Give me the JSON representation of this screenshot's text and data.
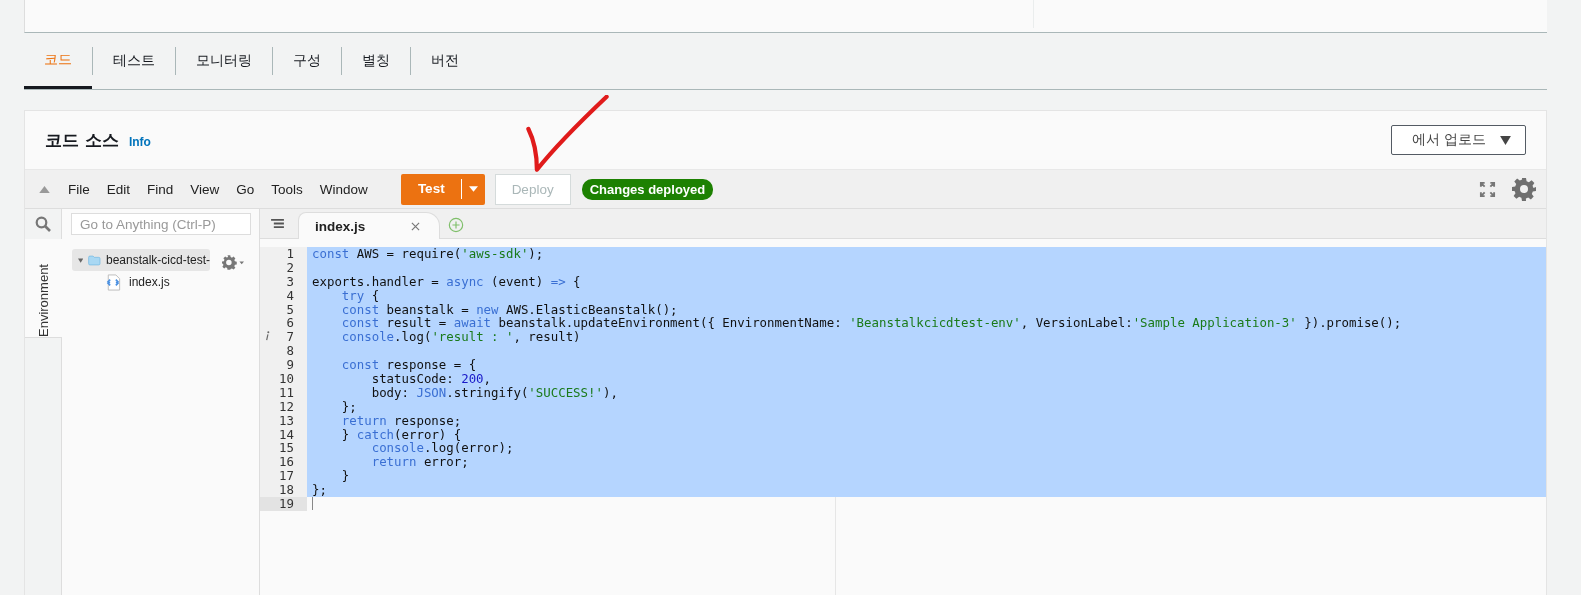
{
  "tabs": [
    {
      "label": "코드",
      "selected": true
    },
    {
      "label": "테스트",
      "selected": false
    },
    {
      "label": "모니터링",
      "selected": false
    },
    {
      "label": "구성",
      "selected": false
    },
    {
      "label": "별칭",
      "selected": false
    },
    {
      "label": "버전",
      "selected": false
    }
  ],
  "code_source": {
    "title": "코드 소스",
    "info_link": "Info",
    "upload_button": "에서 업로드"
  },
  "menu": [
    "File",
    "Edit",
    "Find",
    "View",
    "Go",
    "Tools",
    "Window"
  ],
  "test_button": "Test",
  "deploy_button": {
    "label": "Deploy",
    "disabled": true
  },
  "status_badge": "Changes deployed",
  "search": {
    "placeholder": "Go to Anything (Ctrl-P)"
  },
  "side_tab": "Environment",
  "tree": [
    {
      "name": "beanstalk-cicd-test-",
      "kind": "folder",
      "expanded": true,
      "selected": true,
      "children": [
        {
          "name": "index.js",
          "kind": "file",
          "selected": false
        }
      ]
    }
  ],
  "editor_tabs": [
    {
      "label": "index.js",
      "selected": true
    }
  ],
  "code_lines": [
    {
      "n": "1",
      "selected": true,
      "tokens": [
        {
          "kind": "keyword",
          "t": "const"
        },
        {
          "kind": "plain",
          "t": " AWS = require("
        },
        {
          "kind": "string",
          "t": "'aws-sdk'"
        },
        {
          "kind": "plain",
          "t": ");"
        }
      ]
    },
    {
      "n": "2",
      "selected": true
    },
    {
      "n": "3",
      "selected": true,
      "tokens": [
        {
          "kind": "plain",
          "t": "exports.handler = "
        },
        {
          "kind": "keyword",
          "t": "async"
        },
        {
          "kind": "plain",
          "t": " (event) "
        },
        {
          "kind": "keyword",
          "t": "=>"
        },
        {
          "kind": "plain",
          "t": " {"
        }
      ]
    },
    {
      "n": "4",
      "selected": true,
      "tokens": [
        {
          "kind": "keyword",
          "t": "    try"
        },
        {
          "kind": "plain",
          "t": " {"
        }
      ]
    },
    {
      "n": "5",
      "selected": true,
      "tokens": [
        {
          "kind": "keyword",
          "t": "    const"
        },
        {
          "kind": "plain",
          "t": " beanstalk = "
        },
        {
          "kind": "keyword",
          "t": "new"
        },
        {
          "kind": "plain",
          "t": " AWS.ElasticBeanstalk();"
        }
      ]
    },
    {
      "n": "6",
      "selected": true,
      "tokens": [
        {
          "kind": "keyword",
          "t": "    const"
        },
        {
          "kind": "plain",
          "t": " result = "
        },
        {
          "kind": "keyword",
          "t": "await"
        },
        {
          "kind": "plain",
          "t": " beanstalk.updateEnvironment({ EnvironmentName: "
        },
        {
          "kind": "string",
          "t": "'Beanstalkcicdtest-env'"
        },
        {
          "kind": "plain",
          "t": ", VersionLabel:"
        },
        {
          "kind": "string",
          "t": "'Sample Application-3'"
        },
        {
          "kind": "plain",
          "t": " }).promise();"
        }
      ]
    },
    {
      "n": "7",
      "selected": true,
      "info_marker": true,
      "tokens": [
        {
          "kind": "keyword",
          "t": "    console"
        },
        {
          "kind": "plain",
          "t": ".log("
        },
        {
          "kind": "string",
          "t": "'result : '"
        },
        {
          "kind": "plain",
          "t": ", result)"
        }
      ]
    },
    {
      "n": "8",
      "selected": true
    },
    {
      "n": "9",
      "selected": true,
      "tokens": [
        {
          "kind": "keyword",
          "t": "    const"
        },
        {
          "kind": "plain",
          "t": " response = {"
        }
      ]
    },
    {
      "n": "10",
      "selected": true,
      "tokens": [
        {
          "kind": "plain",
          "t": "        statusCode: "
        },
        {
          "kind": "number",
          "t": "200"
        },
        {
          "kind": "plain",
          "t": ","
        }
      ]
    },
    {
      "n": "11",
      "selected": true,
      "tokens": [
        {
          "kind": "plain",
          "t": "        body: "
        },
        {
          "kind": "keyword",
          "t": "JSON"
        },
        {
          "kind": "plain",
          "t": ".stringify("
        },
        {
          "kind": "string",
          "t": "'SUCCESS!'"
        },
        {
          "kind": "plain",
          "t": "),"
        }
      ]
    },
    {
      "n": "12",
      "selected": true,
      "tokens": [
        {
          "kind": "plain",
          "t": "    };"
        }
      ]
    },
    {
      "n": "13",
      "selected": true,
      "tokens": [
        {
          "kind": "keyword",
          "t": "    return"
        },
        {
          "kind": "plain",
          "t": " response;"
        }
      ]
    },
    {
      "n": "14",
      "selected": true,
      "tokens": [
        {
          "kind": "plain",
          "t": "    } "
        },
        {
          "kind": "keyword",
          "t": "catch"
        },
        {
          "kind": "plain",
          "t": "(error) {"
        }
      ]
    },
    {
      "n": "15",
      "selected": true,
      "tokens": [
        {
          "kind": "keyword",
          "t": "        console"
        },
        {
          "kind": "plain",
          "t": ".log(error);"
        }
      ]
    },
    {
      "n": "16",
      "selected": true,
      "tokens": [
        {
          "kind": "keyword",
          "t": "        return"
        },
        {
          "kind": "plain",
          "t": " error;"
        }
      ]
    },
    {
      "n": "17",
      "selected": true,
      "tokens": [
        {
          "kind": "plain",
          "t": "    }"
        }
      ]
    },
    {
      "n": "18",
      "selected": true,
      "tokens": [
        {
          "kind": "plain",
          "t": "};"
        }
      ]
    },
    {
      "n": "19",
      "selected": false
    }
  ]
}
